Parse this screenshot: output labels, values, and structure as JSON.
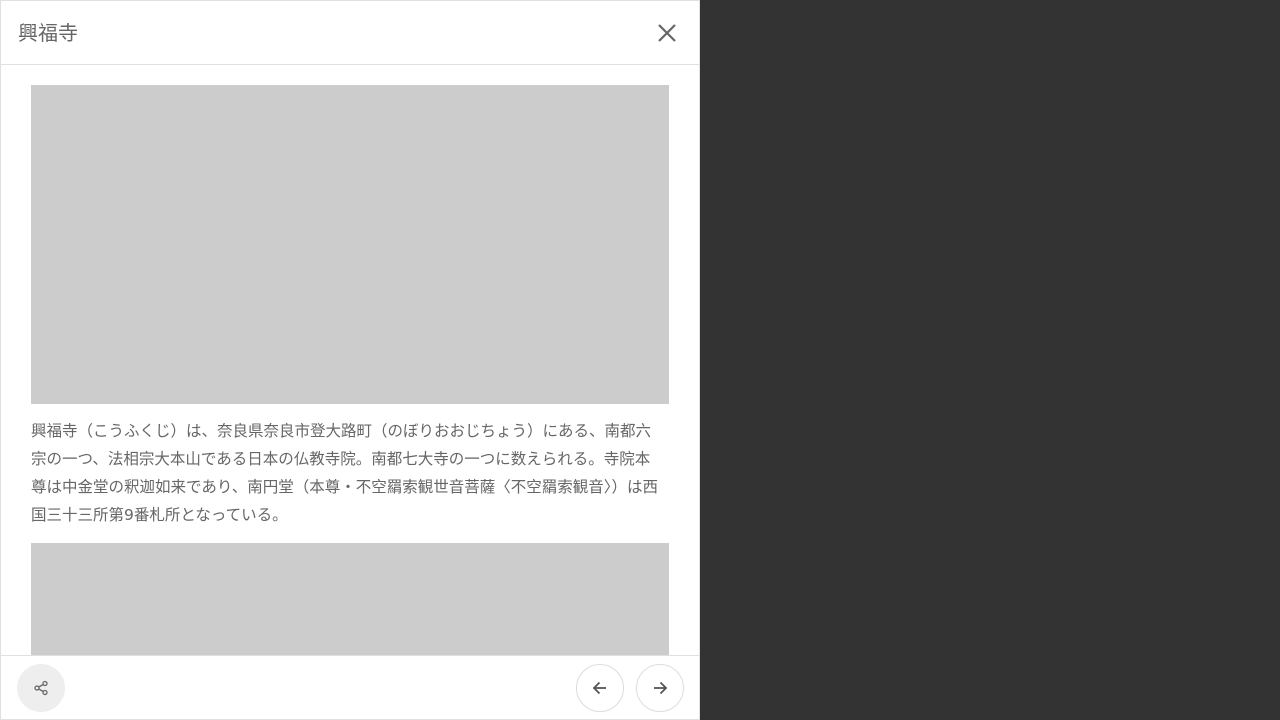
{
  "header": {
    "title": "興福寺"
  },
  "article": {
    "description": "興福寺（こうふくじ）は、奈良県奈良市登大路町（のぼりおおじちょう）にある、南都六宗の一つ、法相宗大本山である日本の仏教寺院。南都七大寺の一つに数えられる。寺院本尊は中金堂の釈迦如来であり、南円堂（本尊・不空羂索観世音菩薩〈不空羂索観音〉）は西国三十三所第9番札所となっている。"
  },
  "icons": {
    "close": "close-icon",
    "share": "share-icon",
    "prev": "arrow-left-icon",
    "next": "arrow-right-icon"
  },
  "colors": {
    "backdrop": "#333333",
    "panel": "#ffffff",
    "text": "#666666",
    "placeholder": "#cccccc"
  }
}
